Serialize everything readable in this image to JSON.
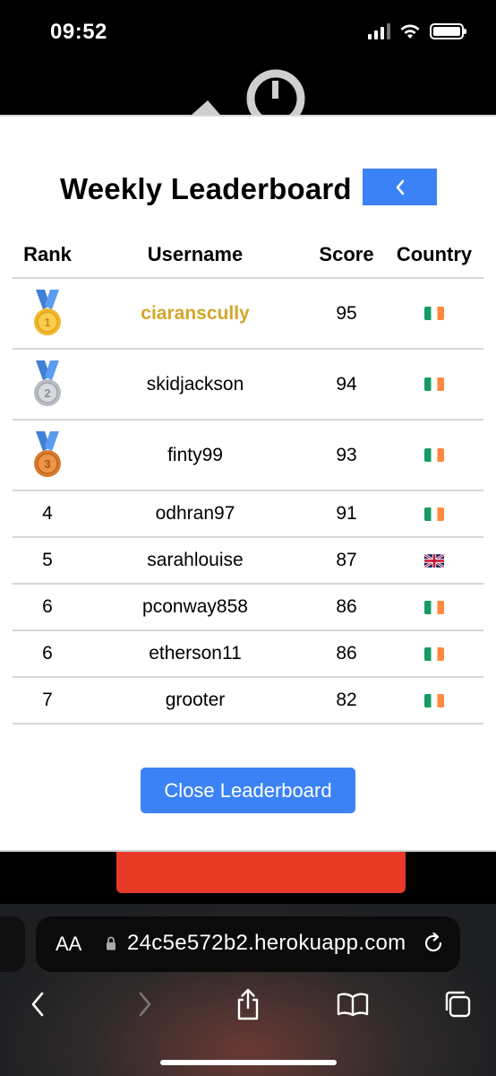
{
  "status_bar": {
    "time": "09:52",
    "icons": [
      "cellular-signal-icon",
      "wifi-icon",
      "battery-icon"
    ]
  },
  "modal": {
    "title": "Weekly Leaderboard",
    "back_button": {
      "icon": "chevron-left-icon",
      "label": "‹"
    },
    "table": {
      "headers": {
        "rank": "Rank",
        "username": "Username",
        "score": "Score",
        "country": "Country"
      },
      "rows": [
        {
          "rank": "",
          "medal": "gold-medal-icon",
          "username": "ciaranscully",
          "score": "95",
          "country": "flag-ireland-icon"
        },
        {
          "rank": "",
          "medal": "silver-medal-icon",
          "username": "skidjackson",
          "score": "94",
          "country": "flag-ireland-icon"
        },
        {
          "rank": "",
          "medal": "bronze-medal-icon",
          "username": "finty99",
          "score": "93",
          "country": "flag-ireland-icon"
        },
        {
          "rank": "4",
          "username": "odhran97",
          "score": "91",
          "country": "flag-ireland-icon"
        },
        {
          "rank": "5",
          "username": "sarahlouise",
          "score": "87",
          "country": "flag-uk-icon"
        },
        {
          "rank": "6",
          "username": "pconway858",
          "score": "86",
          "country": "flag-ireland-icon"
        },
        {
          "rank": "6",
          "username": "etherson11",
          "score": "86",
          "country": "flag-ireland-icon"
        },
        {
          "rank": "7",
          "username": "grooter",
          "score": "82",
          "country": "flag-ireland-icon"
        }
      ]
    },
    "close_button": "Close Leaderboard"
  },
  "browser": {
    "text_size_label": "AA",
    "url": "24c5e572b2.herokuapp.com",
    "icons": [
      "lock-icon",
      "reload-icon",
      "back-icon",
      "forward-icon",
      "share-icon",
      "bookmarks-icon",
      "tabs-icon"
    ]
  },
  "colors": {
    "accent_blue": "#3b82f6",
    "gold_text": "#d4a62a",
    "game_red": "#e83a26",
    "ireland_green": "#169b62",
    "ireland_orange": "#ff883e"
  }
}
